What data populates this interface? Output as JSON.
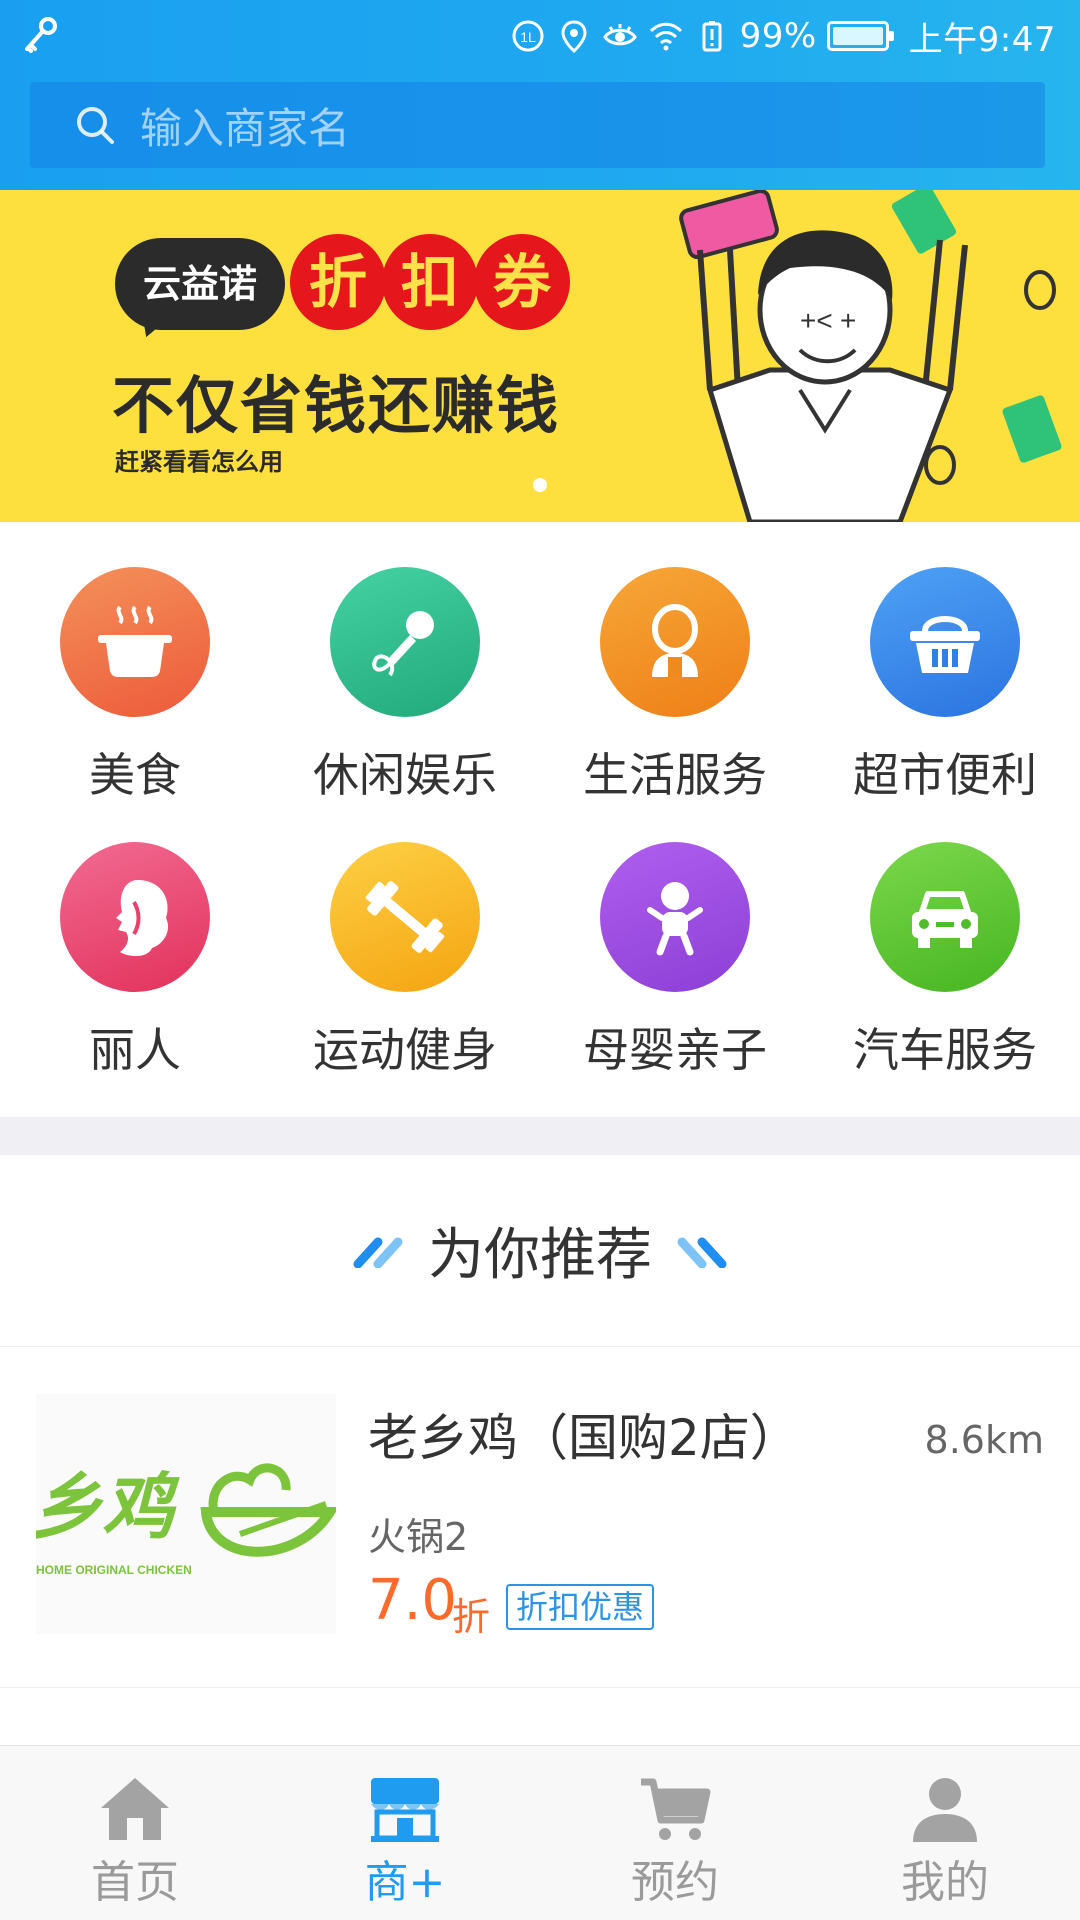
{
  "status_bar": {
    "battery_percent": "99%",
    "time": "上午9:47"
  },
  "search": {
    "placeholder": "输入商家名"
  },
  "banner": {
    "brand": "云益诺",
    "coupon_chars": [
      "折",
      "扣",
      "券"
    ],
    "slogan": "不仅省钱还赚钱",
    "subtitle": "赶紧看看怎么用"
  },
  "categories": [
    {
      "label": "美食",
      "icon": "hotpot-icon",
      "color": "#f26a3e"
    },
    {
      "label": "休闲娱乐",
      "icon": "microphone-icon",
      "color": "#2fbf8f"
    },
    {
      "label": "生活服务",
      "icon": "person-icon",
      "color": "#f08a1f"
    },
    {
      "label": "超市便利",
      "icon": "basket-icon",
      "color": "#2f86ea"
    },
    {
      "label": "丽人",
      "icon": "woman-profile-icon",
      "color": "#ea3f6e"
    },
    {
      "label": "运动健身",
      "icon": "dumbbell-icon",
      "color": "#f6b11b"
    },
    {
      "label": "母婴亲子",
      "icon": "baby-icon",
      "color": "#9a4fe0"
    },
    {
      "label": "汽车服务",
      "icon": "car-icon",
      "color": "#5ec934"
    }
  ],
  "recommend": {
    "title": "为你推荐"
  },
  "shops": [
    {
      "name": "老乡鸡（国购2店）",
      "distance": "8.6km",
      "category": "火锅2",
      "discount": "7.0",
      "discount_unit": "折",
      "tag": "折扣优惠",
      "logo_text": "乡鸡",
      "logo_sub": "HOME ORIGINAL CHICKEN"
    }
  ],
  "tabs": [
    {
      "label": "首页",
      "icon": "home-icon",
      "active": false
    },
    {
      "label": "商+",
      "icon": "storefront-icon",
      "active": true
    },
    {
      "label": "预约",
      "icon": "cart-icon",
      "active": false
    },
    {
      "label": "我的",
      "icon": "user-icon",
      "active": false
    }
  ],
  "colors": {
    "accent": "#1f9bf0",
    "discount": "#ff6a2b",
    "banner_bg": "#fde03e"
  }
}
